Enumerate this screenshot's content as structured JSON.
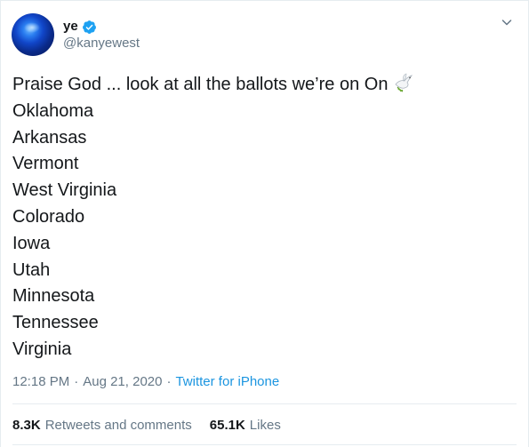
{
  "author": {
    "name": "ye",
    "handle": "@kanyewest"
  },
  "tweet": {
    "lines": [
      "Praise God ... look at all the ballots we’re on On",
      "Oklahoma",
      "Arkansas",
      "Vermont",
      "West Virginia",
      "Colorado",
      "Iowa",
      "Utah",
      "Minnesota",
      "Tennessee",
      "Virginia"
    ],
    "emoji": "dove-with-olive-branch"
  },
  "meta": {
    "time": "12:18 PM",
    "separator1": "·",
    "date": "Aug 21, 2020",
    "separator2": "·",
    "source": "Twitter for iPhone"
  },
  "stats": {
    "retweets_count": "8.3K",
    "retweets_label": "Retweets and comments",
    "likes_count": "65.1K",
    "likes_label": "Likes"
  },
  "colors": {
    "text": "#14171a",
    "secondary": "#657786",
    "link": "#1b95e0",
    "verified": "#1da1f2",
    "border": "#e6ecf0"
  },
  "icons": {
    "verified": "verified-badge-icon",
    "menu": "chevron-down-icon"
  }
}
